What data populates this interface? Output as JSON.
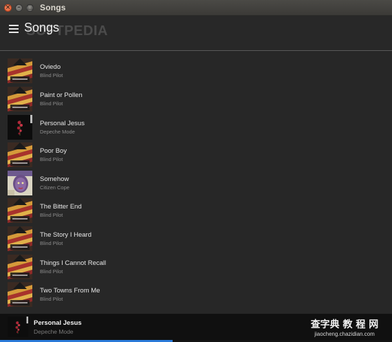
{
  "window": {
    "title": "Songs",
    "close_glyph": "×",
    "minimize_glyph": "–",
    "maximize_glyph": "□"
  },
  "header": {
    "title": "Songs",
    "menu_icon": "hamburger-menu-icon",
    "watermark": "SOFTPEDIA"
  },
  "songs": [
    {
      "title": "Oviedo",
      "artist": "Blind Pilot",
      "art": "blind-pilot"
    },
    {
      "title": "Paint or Pollen",
      "artist": "Blind Pilot",
      "art": "blind-pilot"
    },
    {
      "title": "Personal Jesus",
      "artist": "Depeche Mode",
      "art": "depeche-mode"
    },
    {
      "title": "Poor Boy",
      "artist": "Blind Pilot",
      "art": "blind-pilot"
    },
    {
      "title": "Somehow",
      "artist": "Citizen Cope",
      "art": "citizen-cope"
    },
    {
      "title": "The Bitter End",
      "artist": "Blind Pilot",
      "art": "blind-pilot"
    },
    {
      "title": "The Story I Heard",
      "artist": "Blind Pilot",
      "art": "blind-pilot"
    },
    {
      "title": "Things I Cannot Recall",
      "artist": "Blind Pilot",
      "art": "blind-pilot"
    },
    {
      "title": "Two Towns From Me",
      "artist": "Blind Pilot",
      "art": "blind-pilot"
    }
  ],
  "now_playing": {
    "title": "Personal Jesus",
    "artist": "Depeche Mode",
    "art": "depeche-mode",
    "progress": 0.44
  },
  "corner_watermark": {
    "line1": "查字典 教 程 网",
    "line2": "jiaocheng.chazidian.com"
  },
  "colors": {
    "accent": "#2a7ad8",
    "background": "#272727",
    "text_primary": "#e6e6e6",
    "text_secondary": "#8c8c8c"
  }
}
